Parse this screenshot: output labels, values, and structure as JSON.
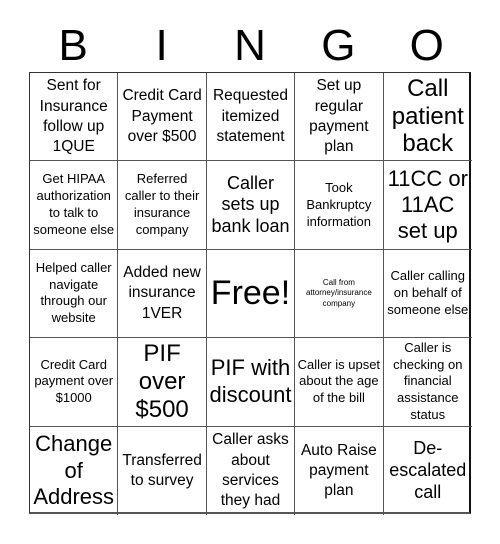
{
  "header": {
    "letters": [
      "B",
      "I",
      "N",
      "G",
      "O"
    ]
  },
  "cells": [
    [
      "Sent for Insurance follow up 1QUE",
      "Credit Card Payment over $500",
      "Requested itemized statement",
      "Set up regular payment plan",
      "Call patient back"
    ],
    [
      "Get HIPAA authorization to talk to someone else",
      "Referred caller to their insurance company",
      "Caller sets up bank loan",
      "Took Bankruptcy information",
      "11CC or 11AC set up"
    ],
    [
      "Helped caller navigate through our website",
      "Added new insurance 1VER",
      "Free!",
      "Call from attorney/insurance company",
      "Caller calling on behalf of someone else"
    ],
    [
      "Credit Card payment over $1000",
      "PIF over $500",
      "PIF with discount",
      "Caller is upset about the age of the bill",
      "Caller is checking on financial assistance status"
    ],
    [
      "Change of Address",
      "Transferred to survey",
      "Caller asks about services they had",
      "Auto Raise payment plan",
      "De-escalated call"
    ]
  ]
}
